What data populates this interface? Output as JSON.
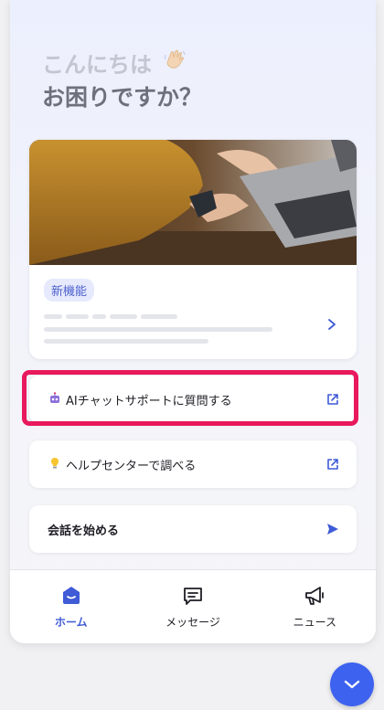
{
  "greeting": {
    "line1": "こんにちは",
    "wave_icon": "waving-hand-icon",
    "line2": "お困りですか？"
  },
  "news_card": {
    "badge": "新機能",
    "image": "person-typing-on-laptop"
  },
  "links": [
    {
      "label": "AIチャットサポートに質問する",
      "icon": "robot-icon",
      "action_icon": "external-link-icon"
    },
    {
      "label": "ヘルプセンターで調べる",
      "icon": "lightbulb-icon",
      "action_icon": "external-link-icon"
    },
    {
      "label": "会話を始める",
      "action_icon": "send-icon"
    }
  ],
  "tabs": [
    {
      "label": "ホーム",
      "icon": "home-icon",
      "active": true
    },
    {
      "label": "メッセージ",
      "icon": "message-icon",
      "active": false
    },
    {
      "label": "ニュース",
      "icon": "megaphone-icon",
      "active": false
    }
  ],
  "colors": {
    "accent": "#3f5bd6",
    "highlight": "#e8195c",
    "fab": "#3d62f0"
  }
}
